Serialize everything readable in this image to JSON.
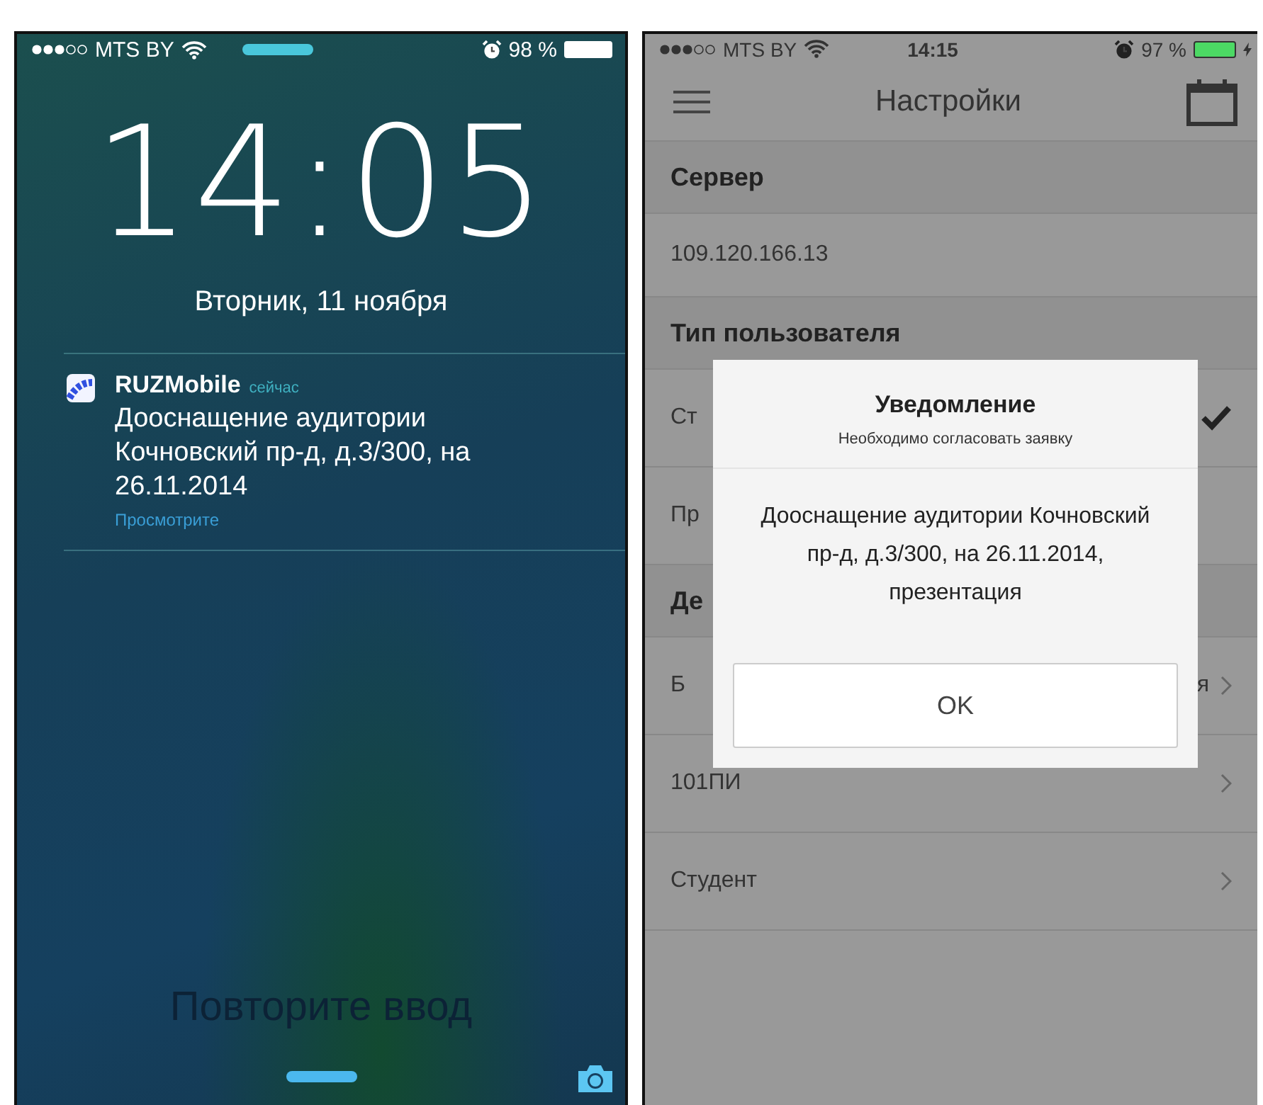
{
  "lock_screen": {
    "status_bar": {
      "carrier": "MTS BY",
      "battery": "98 %"
    },
    "time": "14:05",
    "date": "Вторник, 11 ноября",
    "notification": {
      "app": "RUZMobile",
      "when": "сейчас",
      "message": "Дооснащение аудитории Кочновский пр-д, д.3/300, на 26.11.2014",
      "action": "Просмотрите"
    },
    "unlock_hint": "Повторите ввод"
  },
  "settings_screen": {
    "status_bar": {
      "carrier": "MTS BY",
      "time": "14:15",
      "battery": "97 %"
    },
    "title": "Настройки",
    "sections": [
      {
        "header": "Сервер",
        "rows": [
          {
            "kind": "value",
            "label": "109.120.166.13"
          }
        ]
      },
      {
        "header": "Тип пользователя",
        "rows": [
          {
            "kind": "option",
            "label": "Ст",
            "selected": true
          },
          {
            "kind": "option",
            "label": "Пр",
            "selected": false
          }
        ]
      },
      {
        "header": "Де",
        "rows": [
          {
            "kind": "link",
            "label": "Б",
            "value": "я"
          },
          {
            "kind": "link",
            "label": "101ПИ"
          },
          {
            "kind": "link",
            "label": "Студент"
          }
        ]
      }
    ],
    "dialog": {
      "title": "Уведомление",
      "subtitle": "Необходимо согласовать заявку",
      "message": "Дооснащение аудитории Кочновский пр-д, д.3/300, на 26.11.2014, презентация",
      "button": "OK"
    }
  }
}
